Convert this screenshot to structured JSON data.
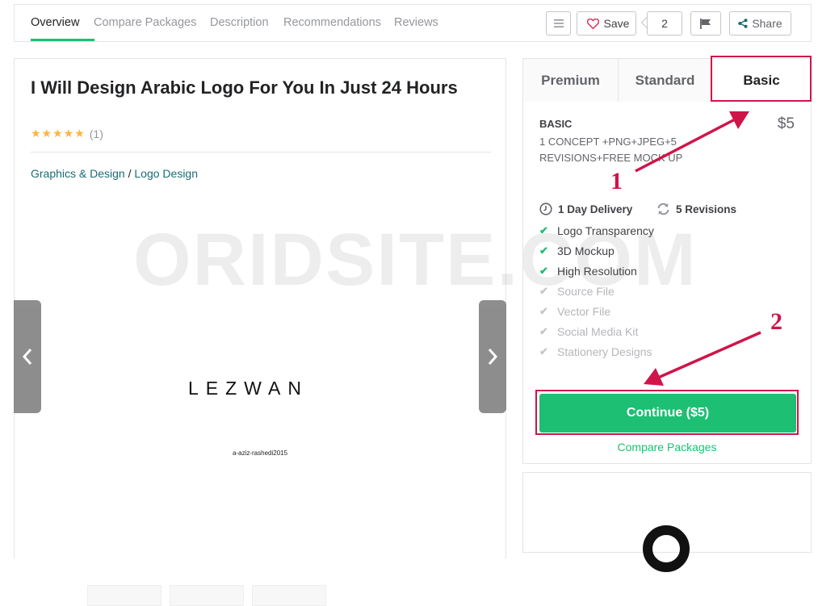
{
  "nav": {
    "tabs": [
      "Overview",
      "Compare Packages",
      "Description",
      "Recommendations",
      "Reviews"
    ],
    "save_label": "Save",
    "save_count": "2",
    "share_label": "Share"
  },
  "gig": {
    "title": "I Will Design Arabic Logo For You In Just 24 Hours",
    "stars": "★★★★★",
    "rating_count": "(1)",
    "breadcrumb": [
      "Graphics & Design",
      "/",
      "Logo Design"
    ]
  },
  "gallery": {
    "brand_word": "LEZWAN",
    "credit": "a-aziz-rashedi2015"
  },
  "watermark": "ORIDSITE.COM",
  "packages": {
    "tabs": [
      "Premium",
      "Standard",
      "Basic"
    ],
    "selected": "Basic",
    "name": "BASIC",
    "price": "$5",
    "description": "1 CONCEPT +PNG+JPEG+5 REVISIONS+FREE MOCK UP",
    "delivery": "1 Day Delivery",
    "revisions": "5 Revisions",
    "features": [
      {
        "label": "Logo Transparency",
        "included": true
      },
      {
        "label": "3D Mockup",
        "included": true
      },
      {
        "label": "High Resolution",
        "included": true
      },
      {
        "label": "Source File",
        "included": false
      },
      {
        "label": "Vector File",
        "included": false
      },
      {
        "label": "Social Media Kit",
        "included": false
      },
      {
        "label": "Stationery Designs",
        "included": false
      }
    ],
    "continue_label": "Continue ($5)",
    "compare_label": "Compare Packages"
  },
  "annotations": {
    "step1": "1",
    "step2": "2",
    "color": "#d0144a"
  },
  "colors": {
    "accent": "#1dbf73",
    "link": "#1a6b73",
    "star": "#ffb33e"
  }
}
